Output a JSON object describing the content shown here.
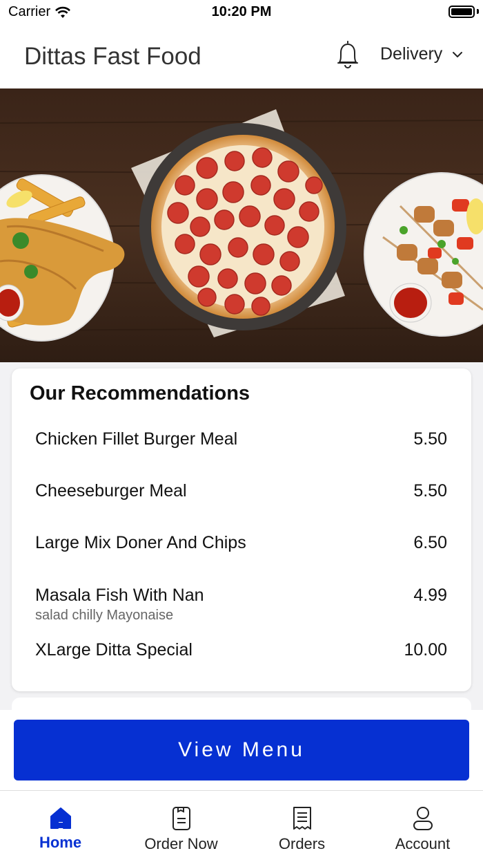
{
  "status_bar": {
    "carrier": "Carrier",
    "time": "10:20 PM"
  },
  "header": {
    "title": "Dittas Fast Food",
    "delivery_mode": "Delivery"
  },
  "recommendations": {
    "title": "Our Recommendations",
    "items": [
      {
        "name": "Chicken Fillet Burger Meal",
        "price": "5.50",
        "description": ""
      },
      {
        "name": "Cheeseburger Meal",
        "price": "5.50",
        "description": ""
      },
      {
        "name": "Large Mix Doner And Chips",
        "price": "6.50",
        "description": ""
      },
      {
        "name": "Masala Fish With Nan",
        "price": "4.99",
        "description": "salad chilly Mayonaise"
      },
      {
        "name": "XLarge Ditta Special",
        "price": "10.00",
        "description": ""
      }
    ]
  },
  "view_menu_label": "View Menu",
  "tabs": [
    {
      "label": "Home",
      "icon": "home-icon",
      "active": true
    },
    {
      "label": "Order Now",
      "icon": "order-now-icon",
      "active": false
    },
    {
      "label": "Orders",
      "icon": "receipt-icon",
      "active": false
    },
    {
      "label": "Account",
      "icon": "account-icon",
      "active": false
    }
  ],
  "colors": {
    "accent": "#0630d2"
  }
}
